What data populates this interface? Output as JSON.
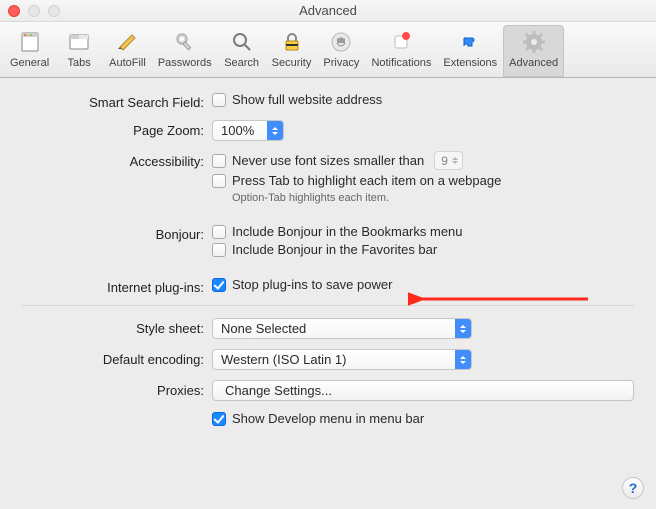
{
  "window": {
    "title": "Advanced"
  },
  "toolbar": {
    "items": [
      {
        "id": "general",
        "label": "General"
      },
      {
        "id": "tabs",
        "label": "Tabs"
      },
      {
        "id": "autofill",
        "label": "AutoFill"
      },
      {
        "id": "passwords",
        "label": "Passwords"
      },
      {
        "id": "search",
        "label": "Search"
      },
      {
        "id": "security",
        "label": "Security"
      },
      {
        "id": "privacy",
        "label": "Privacy"
      },
      {
        "id": "notifications",
        "label": "Notifications"
      },
      {
        "id": "extensions",
        "label": "Extensions"
      },
      {
        "id": "advanced",
        "label": "Advanced"
      }
    ],
    "selected": "advanced"
  },
  "sections": {
    "smart_search": {
      "label": "Smart Search Field:",
      "show_full_address": {
        "text": "Show full website address",
        "checked": false
      }
    },
    "page_zoom": {
      "label": "Page Zoom:",
      "value": "100%"
    },
    "accessibility": {
      "label": "Accessibility:",
      "min_font": {
        "text": "Never use font sizes smaller than",
        "checked": false,
        "value": "9"
      },
      "press_tab": {
        "text": "Press Tab to highlight each item on a webpage",
        "checked": false
      },
      "hint": "Option-Tab highlights each item."
    },
    "bonjour": {
      "label": "Bonjour:",
      "bookmarks": {
        "text": "Include Bonjour in the Bookmarks menu",
        "checked": false
      },
      "favorites": {
        "text": "Include Bonjour in the Favorites bar",
        "checked": false
      }
    },
    "plugins": {
      "label": "Internet plug-ins:",
      "save_power": {
        "text": "Stop plug-ins to save power",
        "checked": true
      }
    },
    "stylesheet": {
      "label": "Style sheet:",
      "value": "None Selected"
    },
    "encoding": {
      "label": "Default encoding:",
      "value": "Western (ISO Latin 1)"
    },
    "proxies": {
      "label": "Proxies:",
      "button": "Change Settings..."
    },
    "develop": {
      "text": "Show Develop menu in menu bar",
      "checked": true
    }
  },
  "help": "?"
}
